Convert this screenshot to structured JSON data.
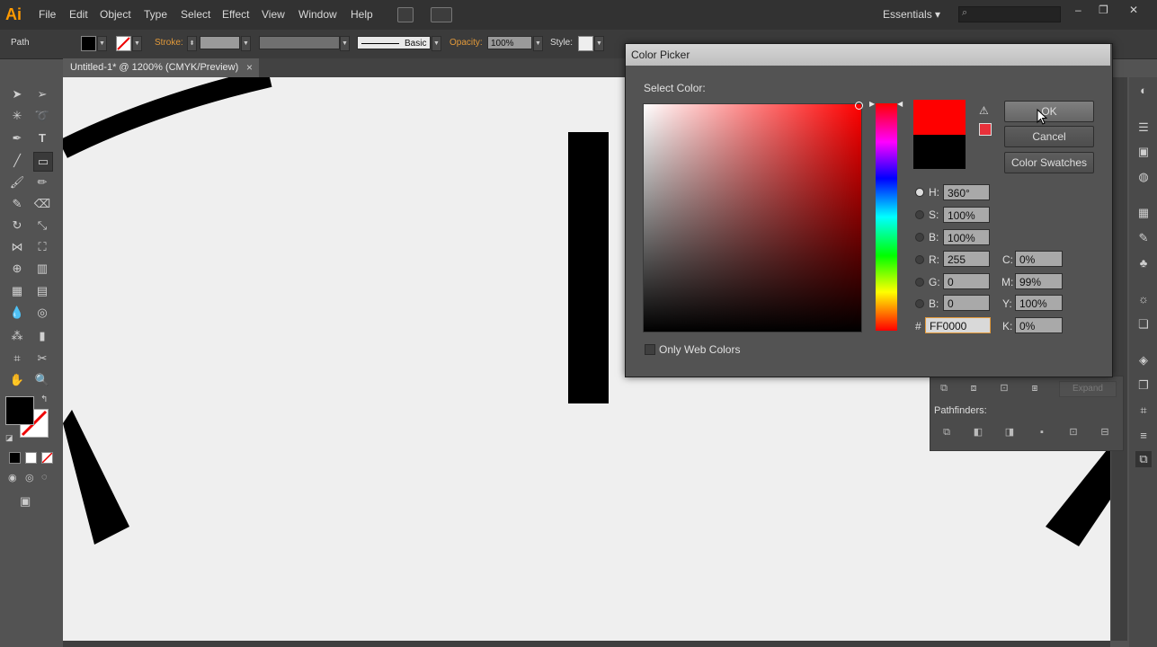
{
  "app": {
    "logo": "Ai"
  },
  "menu": [
    "File",
    "Edit",
    "Object",
    "Type",
    "Select",
    "Effect",
    "View",
    "Window",
    "Help"
  ],
  "workspace": "Essentials",
  "window_controls": [
    "–",
    "❐",
    "✕"
  ],
  "control_bar": {
    "selection_label": "Path",
    "stroke_label": "Stroke:",
    "brush_label": "Basic",
    "opacity_label": "Opacity:",
    "opacity_value": "100%",
    "style_label": "Style:"
  },
  "document_tab": {
    "title": "Untitled-1* @ 1200% (CMYK/Preview)",
    "close": "×"
  },
  "color_picker": {
    "title": "Color Picker",
    "select_color_label": "Select Color:",
    "ok": "OK",
    "cancel": "Cancel",
    "color_swatches": "Color Swatches",
    "only_web_colors": "Only Web Colors",
    "hsb": [
      {
        "label": "H:",
        "value": "360°"
      },
      {
        "label": "S:",
        "value": "100%"
      },
      {
        "label": "B:",
        "value": "100%"
      }
    ],
    "rgb": [
      {
        "label": "R:",
        "value": "255"
      },
      {
        "label": "G:",
        "value": "0"
      },
      {
        "label": "B:",
        "value": "0"
      }
    ],
    "cmyk": [
      {
        "label": "C:",
        "value": "0%"
      },
      {
        "label": "M:",
        "value": "99%"
      },
      {
        "label": "Y:",
        "value": "100%"
      },
      {
        "label": "K:",
        "value": "0%"
      }
    ],
    "hex_label": "#",
    "hex_value": "FF0000",
    "new_color": "#ff0000",
    "original_color": "#000000"
  },
  "pathfinder": {
    "pathfinders_label": "Pathfinders:",
    "expand_label": "Expand"
  },
  "colors": {
    "fill": "#000000",
    "accent": "#ff9a00"
  }
}
